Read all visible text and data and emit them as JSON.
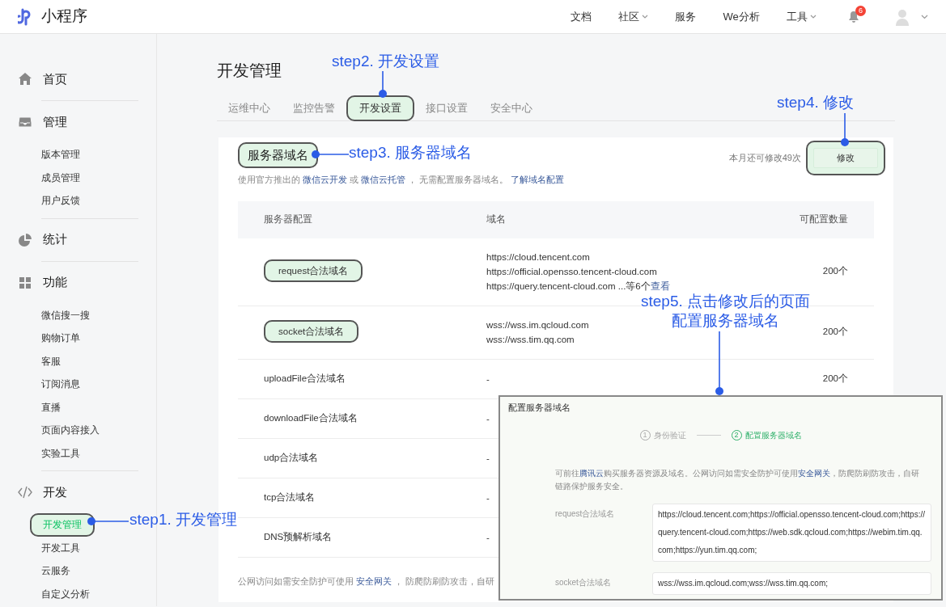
{
  "topbar": {
    "logo_text": "小程序",
    "nav": [
      {
        "label": "文档",
        "dropdown": false
      },
      {
        "label": "社区",
        "dropdown": true
      },
      {
        "label": "服务",
        "dropdown": false
      },
      {
        "label": "We分析",
        "dropdown": false
      },
      {
        "label": "工具",
        "dropdown": true
      }
    ],
    "notification_badge": "6"
  },
  "sidebar": [
    {
      "title": "首页"
    },
    {
      "title": "管理",
      "items": [
        {
          "label": "版本管理",
          "selected": false,
          "highlighted": false
        },
        {
          "label": "成员管理",
          "selected": false,
          "highlighted": false
        },
        {
          "label": "用户反馈",
          "selected": false,
          "highlighted": false
        }
      ]
    },
    {
      "title": "统计"
    },
    {
      "title": "功能",
      "items": [
        {
          "label": "微信搜一搜",
          "selected": false,
          "highlighted": false
        },
        {
          "label": "购物订单",
          "selected": false,
          "highlighted": false
        },
        {
          "label": "客服",
          "selected": false,
          "highlighted": false
        },
        {
          "label": "订阅消息",
          "selected": false,
          "highlighted": false
        },
        {
          "label": "直播",
          "selected": false,
          "highlighted": false
        },
        {
          "label": "页面内容接入",
          "selected": false,
          "highlighted": false
        },
        {
          "label": "实验工具",
          "selected": false,
          "highlighted": false
        }
      ]
    },
    {
      "title": "开发",
      "items": [
        {
          "label": "开发管理",
          "selected": true,
          "highlighted": true
        },
        {
          "label": "开发工具",
          "selected": false,
          "highlighted": false
        },
        {
          "label": "云服务",
          "selected": false,
          "highlighted": false
        },
        {
          "label": "自定义分析",
          "selected": false,
          "highlighted": false
        }
      ]
    }
  ],
  "page_title": "开发管理",
  "tabs": [
    {
      "label": "运维中心",
      "selected": false,
      "highlighted": false
    },
    {
      "label": "监控告警",
      "selected": false,
      "highlighted": false
    },
    {
      "label": "开发设置",
      "selected": true,
      "highlighted": true
    },
    {
      "label": "接口设置",
      "selected": false,
      "highlighted": false
    },
    {
      "label": "安全中心",
      "selected": false,
      "highlighted": false
    }
  ],
  "section": {
    "title": "服务器域名",
    "title_highlighted": true,
    "quota": "本月还可修改49次",
    "edit_button": "修改",
    "edit_highlighted": true,
    "description": [
      {
        "text": "使用官方推出的 ",
        "link": false
      },
      {
        "text": "微信云开发",
        "link": true
      },
      {
        "text": " 或 ",
        "link": false
      },
      {
        "text": "微信云托管",
        "link": true
      },
      {
        "text": " ， 无需配置服务器域名。 ",
        "link": false
      },
      {
        "text": "了解域名配置",
        "link": true
      }
    ],
    "table": {
      "columns": [
        "服务器配置",
        "域名",
        "可配置数量"
      ],
      "rows": [
        {
          "name": "request合法域名",
          "highlighted": true,
          "domains": [
            "https://cloud.tencent.com",
            "https://official.opensso.tencent-cloud.com",
            "https://query.tencent-cloud.com ...等6个"
          ],
          "more_link": "查看",
          "count": "200个"
        },
        {
          "name": "socket合法域名",
          "highlighted": true,
          "domains": [
            "wss://wss.im.qcloud.com",
            "wss://wss.tim.qq.com"
          ],
          "count": "200个"
        },
        {
          "name": "uploadFile合法域名",
          "highlighted": false,
          "domains": [
            "-"
          ],
          "count": "200个"
        },
        {
          "name": "downloadFile合法域名",
          "highlighted": false,
          "domains": [
            "-"
          ]
        },
        {
          "name": "udp合法域名",
          "highlighted": false,
          "domains": [
            "-"
          ]
        },
        {
          "name": "tcp合法域名",
          "highlighted": false,
          "domains": [
            "-"
          ]
        },
        {
          "name": "DNS预解析域名",
          "highlighted": false,
          "domains": [
            "-"
          ]
        }
      ]
    },
    "footer": [
      {
        "text": "公网访问如需安全防护可使用 ",
        "link": false
      },
      {
        "text": "安全网关",
        "link": true
      },
      {
        "text": " ， 防爬防刷防攻击，自研",
        "link": false
      }
    ]
  },
  "dialog": {
    "title": "配置服务器域名",
    "steps": [
      {
        "number": "1",
        "label": "身份验证",
        "selected": false
      },
      {
        "number": "2",
        "label": "配置服务器域名",
        "selected": true
      }
    ],
    "notice": [
      {
        "text": "可前往",
        "link": false
      },
      {
        "text": "腾讯云",
        "link": true
      },
      {
        "text": "购买服务器资源及域名。公网访问如需安全防护可使用",
        "link": false
      },
      {
        "text": "安全网关",
        "link": true
      },
      {
        "text": "，防爬防刷防攻击，自研链路保护服务安全。",
        "link": false
      }
    ],
    "fields": [
      {
        "label": "request合法域名",
        "value": "https://cloud.tencent.com;https://official.opensso.tencent-cloud.com;https://query.tencent-cloud.com;https://web.sdk.qcloud.com;https://webim.tim.qq.com;https://yun.tim.qq.com;"
      },
      {
        "label": "socket合法域名",
        "value": "wss://wss.im.qcloud.com;wss://wss.tim.qq.com;"
      }
    ]
  },
  "annotations": [
    {
      "lines": [
        "step1. 开发管理"
      ]
    },
    {
      "lines": [
        "step2. 开发设置"
      ]
    },
    {
      "lines": [
        "step3. 服务器域名"
      ]
    },
    {
      "lines": [
        "step4. 修改"
      ]
    },
    {
      "lines": [
        "step5. 点击修改后的页面",
        "配置服务器域名"
      ]
    }
  ]
}
